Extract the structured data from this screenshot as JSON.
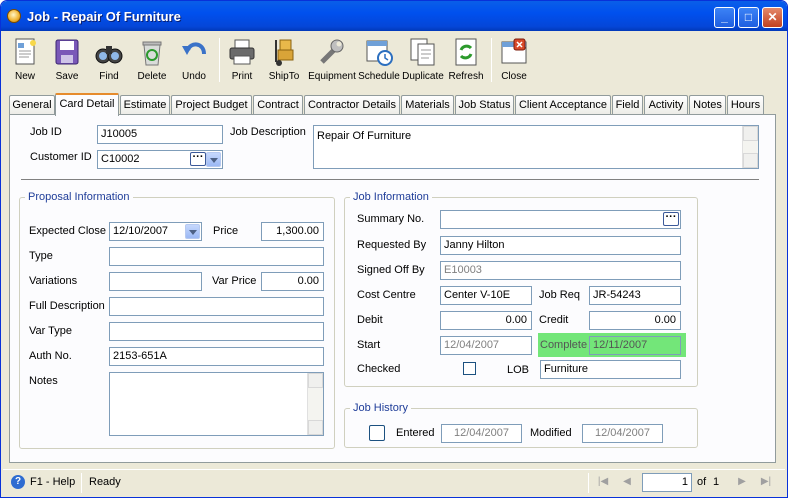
{
  "window": {
    "title": "Job - Repair Of Furniture"
  },
  "toolbar": {
    "new": "New",
    "save": "Save",
    "find": "Find",
    "delete": "Delete",
    "undo": "Undo",
    "print": "Print",
    "shipto": "ShipTo",
    "equipment": "Equipment",
    "schedule": "Schedule",
    "duplicate": "Duplicate",
    "refresh": "Refresh",
    "close": "Close"
  },
  "tabs": [
    "General",
    "Card Detail",
    "Estimate",
    "Project Budget",
    "Contract",
    "Contractor Details",
    "Materials",
    "Job Status",
    "Client Acceptance",
    "Field",
    "Activity",
    "Notes",
    "Hours"
  ],
  "active_tab": "Card Detail",
  "header": {
    "job_id_label": "Job ID",
    "job_id": "J10005",
    "customer_id_label": "Customer ID",
    "customer_id": "C10002",
    "job_description_label": "Job Description",
    "job_description": "Repair Of Furniture"
  },
  "proposal": {
    "title": "Proposal Information",
    "expected_close_label": "Expected Close",
    "expected_close": "12/10/2007",
    "price_label": "Price",
    "price": "1,300.00",
    "type_label": "Type",
    "type": "",
    "variations_label": "Variations",
    "variations": "",
    "var_price_label": "Var Price",
    "var_price": "0.00",
    "full_description_label": "Full Description",
    "full_description": "",
    "var_type_label": "Var Type",
    "var_type": "",
    "auth_no_label": "Auth No.",
    "auth_no": "2153-651A",
    "notes_label": "Notes",
    "notes": ""
  },
  "job_info": {
    "title": "Job Information",
    "summary_no_label": "Summary No.",
    "summary_no": "",
    "requested_by_label": "Requested By",
    "requested_by": "Janny Hilton",
    "signed_off_by_label": "Signed Off By",
    "signed_off_by": "E10003",
    "cost_centre_label": "Cost Centre",
    "cost_centre": "Center V-10E",
    "job_req_label": "Job Req",
    "job_req": "JR-54243",
    "debit_label": "Debit",
    "debit": "0.00",
    "credit_label": "Credit",
    "credit": "0.00",
    "start_label": "Start",
    "start": "12/04/2007",
    "complete_label": "Complete",
    "complete": "12/11/2007",
    "checked_label": "Checked",
    "lob_label": "LOB",
    "lob": "Furniture"
  },
  "job_history": {
    "title": "Job History",
    "entered_label": "Entered",
    "entered": "12/04/2007",
    "modified_label": "Modified",
    "modified": "12/04/2007"
  },
  "statusbar": {
    "help": "F1 - Help",
    "status": "Ready",
    "page": "1",
    "of_label": "of",
    "total": "1"
  },
  "colors": {
    "complete_highlight": "#73e679",
    "titlebar": "#0050ee",
    "active_tab_accent": "#e68b2c"
  }
}
